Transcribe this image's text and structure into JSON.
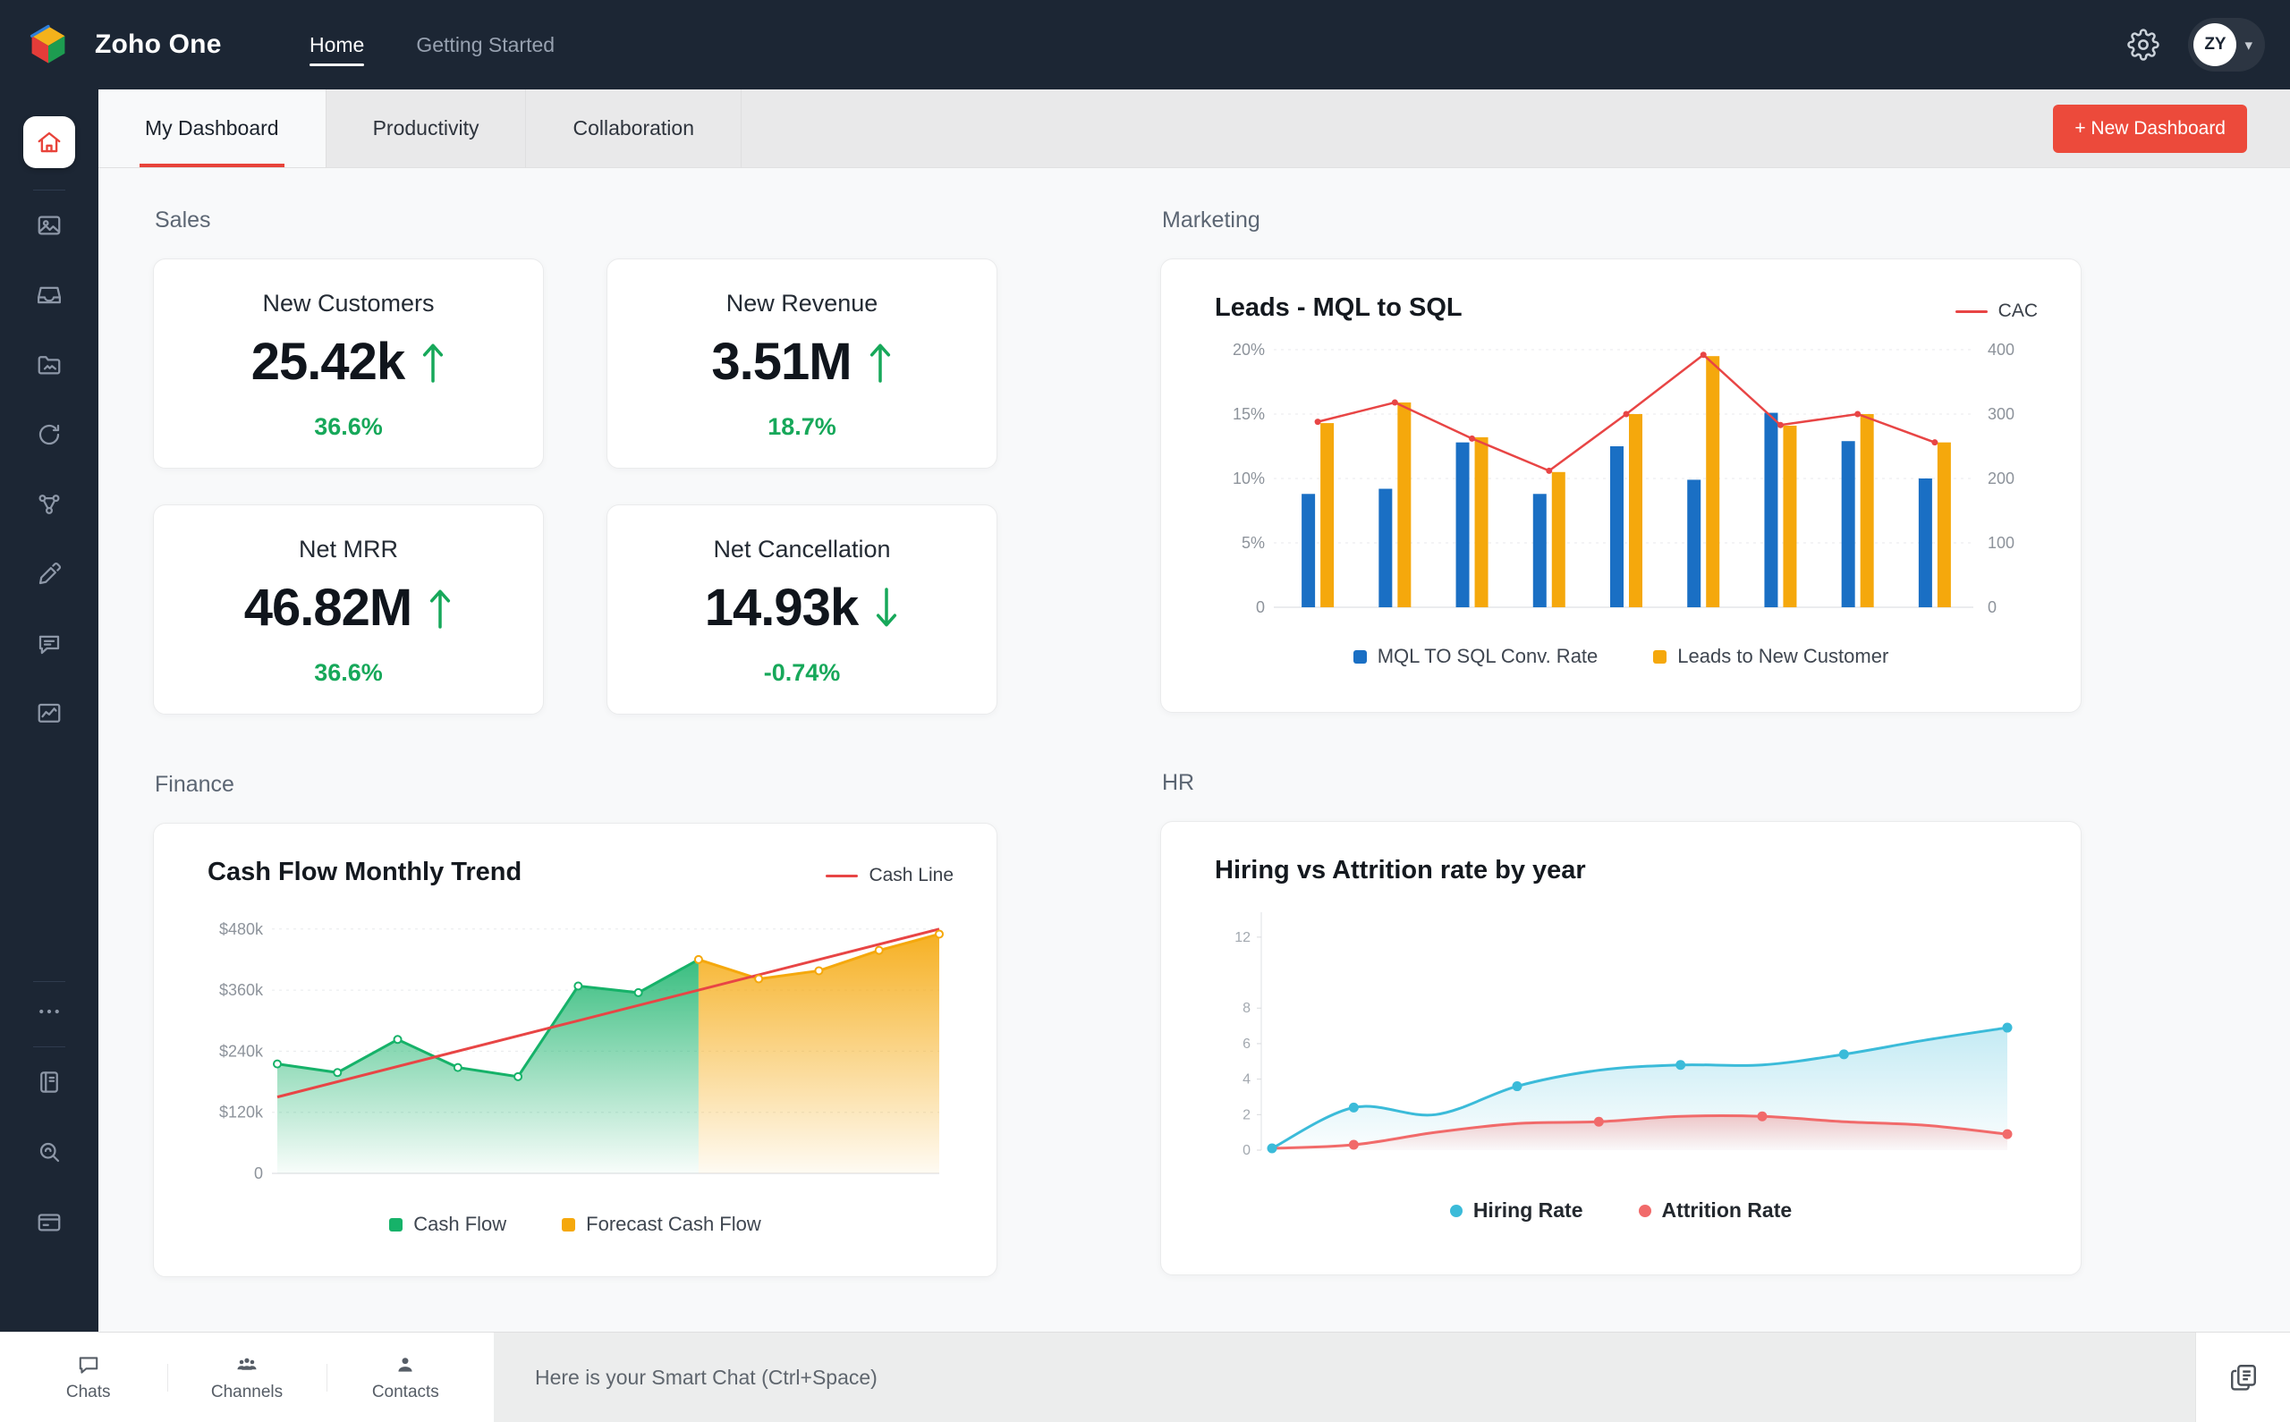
{
  "theme": {
    "topbar_bg": "#1C2634",
    "accent_red": "#EC4A3B",
    "tab_underline": "#E8433A",
    "positive_green": "#17A85A",
    "bar_blue": "#1A6FC4",
    "bar_orange": "#F5A80C",
    "line_red": "#E84545",
    "hiring_cyan": "#3BBBD9",
    "attrition_pink": "#F16A6A"
  },
  "topbar": {
    "brand": "Zoho One",
    "nav": [
      {
        "label": "Home",
        "active": true
      },
      {
        "label": "Getting Started",
        "active": false
      }
    ],
    "avatar_initials": "ZY"
  },
  "sidebar": {
    "items": [
      {
        "icon": "home-icon",
        "active": true
      },
      {
        "icon": "divider"
      },
      {
        "icon": "gallery-icon"
      },
      {
        "icon": "inbox-icon"
      },
      {
        "icon": "folder-icon"
      },
      {
        "icon": "sync-icon"
      },
      {
        "icon": "integrations-icon"
      },
      {
        "icon": "signature-icon"
      },
      {
        "icon": "feedback-icon"
      },
      {
        "icon": "analytics-icon"
      },
      {
        "icon": "divider",
        "push": true
      },
      {
        "icon": "more-icon"
      },
      {
        "icon": "divider"
      },
      {
        "icon": "notebook-icon"
      },
      {
        "icon": "search-icon"
      },
      {
        "icon": "wallet-icon"
      }
    ]
  },
  "tabs": {
    "items": [
      {
        "label": "My Dashboard",
        "active": true
      },
      {
        "label": "Productivity",
        "active": false
      },
      {
        "label": "Collaboration",
        "active": false
      }
    ],
    "new_dashboard_label": "+ New Dashboard"
  },
  "sections": {
    "sales": {
      "title": "Sales",
      "kpis": [
        {
          "title": "New Customers",
          "value": "25.42k",
          "direction": "up",
          "change": "36.6%"
        },
        {
          "title": "New Revenue",
          "value": "3.51M",
          "direction": "up",
          "change": "18.7%"
        },
        {
          "title": "Net MRR",
          "value": "46.82M",
          "direction": "up",
          "change": "36.6%"
        },
        {
          "title": "Net Cancellation",
          "value": "14.93k",
          "direction": "down",
          "change": "-0.74%"
        }
      ]
    },
    "marketing": {
      "title": "Marketing"
    },
    "finance": {
      "title": "Finance"
    },
    "hr": {
      "title": "HR"
    }
  },
  "chart_data": [
    {
      "id": "leads",
      "type": "bar",
      "title": "Leads - MQL to SQL",
      "left_axis": {
        "max": 20,
        "tick_values": [
          0,
          5,
          10,
          15,
          20
        ],
        "tick_labels": [
          "0",
          "5%",
          "10%",
          "15%",
          "20%"
        ]
      },
      "right_axis": {
        "max": 400,
        "tick_labels": [
          "0",
          "100",
          "200",
          "300",
          "400"
        ]
      },
      "series": [
        {
          "name": "MQL TO SQL Conv. Rate",
          "type": "bar",
          "axis": "left",
          "color": "#1A6FC4",
          "values": [
            8.8,
            9.2,
            12.8,
            8.8,
            12.5,
            9.9,
            15.1,
            12.9,
            10.0
          ]
        },
        {
          "name": "Leads to New Customer",
          "type": "bar",
          "axis": "left",
          "color": "#F5A80C",
          "values": [
            14.3,
            15.9,
            13.2,
            10.5,
            15.0,
            19.5,
            14.1,
            15.0,
            12.8
          ]
        },
        {
          "name": "CAC",
          "type": "line",
          "axis": "right",
          "color": "#E84545",
          "values": [
            288,
            318,
            262,
            212,
            300,
            392,
            283,
            300,
            256
          ]
        }
      ],
      "legend_position": "bottom"
    },
    {
      "id": "cashflow",
      "type": "area",
      "title": "Cash Flow Monthly Trend",
      "y_axis": {
        "max": 520,
        "tick_values": [
          0,
          120,
          240,
          360,
          480
        ],
        "tick_labels": [
          "0",
          "$120k",
          "$240k",
          "$360k",
          "$480k"
        ]
      },
      "values_k": [
        215,
        198,
        263,
        208,
        190,
        368,
        355,
        420,
        382,
        398,
        438,
        470
      ],
      "forecast_start_index": 7,
      "series": [
        {
          "name": "Cash Flow",
          "color": "#16B269"
        },
        {
          "name": "Forecast Cash Flow",
          "color": "#F5A80C"
        }
      ],
      "trend": {
        "name": "Cash Line",
        "color": "#E84545",
        "start": 150,
        "end": 480
      },
      "legend_position": "bottom"
    },
    {
      "id": "hiring",
      "type": "line",
      "title": "Hiring vs Attrition rate by year",
      "y_axis": {
        "max": 13,
        "tick_values": [
          0,
          2,
          4,
          6,
          8,
          12
        ],
        "tick_labels": [
          "0",
          "2",
          "4",
          "6",
          "8",
          "12"
        ]
      },
      "series": [
        {
          "name": "Hiring Rate",
          "color": "#3BBBD9",
          "values": [
            0.1,
            2.4,
            2.0,
            3.6,
            4.5,
            4.8,
            4.8,
            5.4,
            6.2,
            6.9
          ],
          "dot_indices": [
            0,
            1,
            3,
            5,
            7,
            9
          ]
        },
        {
          "name": "Attrition Rate",
          "color": "#F16A6A",
          "values": [
            0.1,
            0.3,
            1.0,
            1.5,
            1.6,
            1.9,
            1.9,
            1.6,
            1.4,
            0.9
          ],
          "dot_indices": [
            1,
            4,
            6,
            9
          ]
        }
      ],
      "legend_position": "bottom"
    }
  ],
  "bottombar": {
    "items": [
      {
        "icon": "chats-icon",
        "label": "Chats"
      },
      {
        "icon": "channels-icon",
        "label": "Channels"
      },
      {
        "icon": "contacts-icon",
        "label": "Contacts"
      }
    ],
    "placeholder": "Here is your Smart Chat (Ctrl+Space)"
  }
}
